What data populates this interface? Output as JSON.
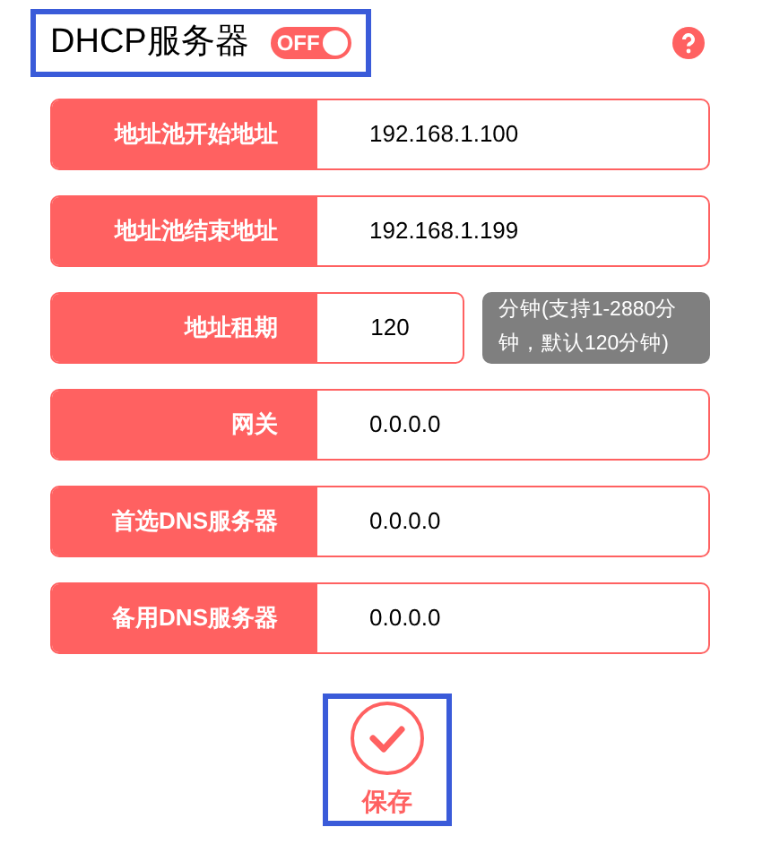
{
  "header": {
    "title": "DHCP服务器",
    "toggle": {
      "label": "OFF",
      "on": true
    }
  },
  "fields": [
    {
      "label": "地址池开始地址",
      "value": "192.168.1.100"
    },
    {
      "label": "地址池结束地址",
      "value": "192.168.1.199"
    },
    {
      "label": "地址租期",
      "value": "120",
      "hint": "分钟(支持1-2880分钟，默认120分钟)"
    },
    {
      "label": "网关",
      "value": "0.0.0.0"
    },
    {
      "label": "首选DNS服务器",
      "value": "0.0.0.0"
    },
    {
      "label": "备用DNS服务器",
      "value": "0.0.0.0"
    }
  ],
  "save_button": {
    "label": "保存"
  }
}
